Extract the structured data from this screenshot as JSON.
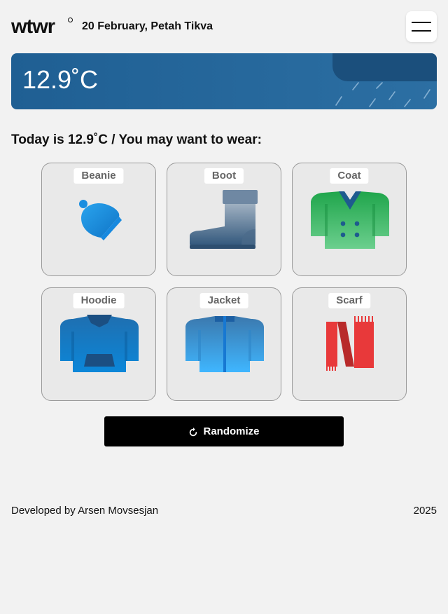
{
  "header": {
    "logo_text": "wtwr",
    "date_location": "20 February, Petah Tikva"
  },
  "weather": {
    "temperature": "12.9˚C",
    "condition_icon": "rain-cloud-icon"
  },
  "recommendation": {
    "text": "Today is 12.9˚C / You may want to wear:"
  },
  "items": [
    {
      "label": "Beanie",
      "icon": "beanie-icon"
    },
    {
      "label": "Boot",
      "icon": "boot-icon"
    },
    {
      "label": "Coat",
      "icon": "coat-icon"
    },
    {
      "label": "Hoodie",
      "icon": "hoodie-icon"
    },
    {
      "label": "Jacket",
      "icon": "jacket-icon"
    },
    {
      "label": "Scarf",
      "icon": "scarf-icon"
    }
  ],
  "actions": {
    "randomize_label": "Randomize"
  },
  "footer": {
    "credit": "Developed by Arsen Movsesjan",
    "year": "2025"
  },
  "colors": {
    "banner": "#2c6fa3",
    "button": "#000000",
    "background": "#f2f2f2",
    "card": "#e9e9e9"
  }
}
